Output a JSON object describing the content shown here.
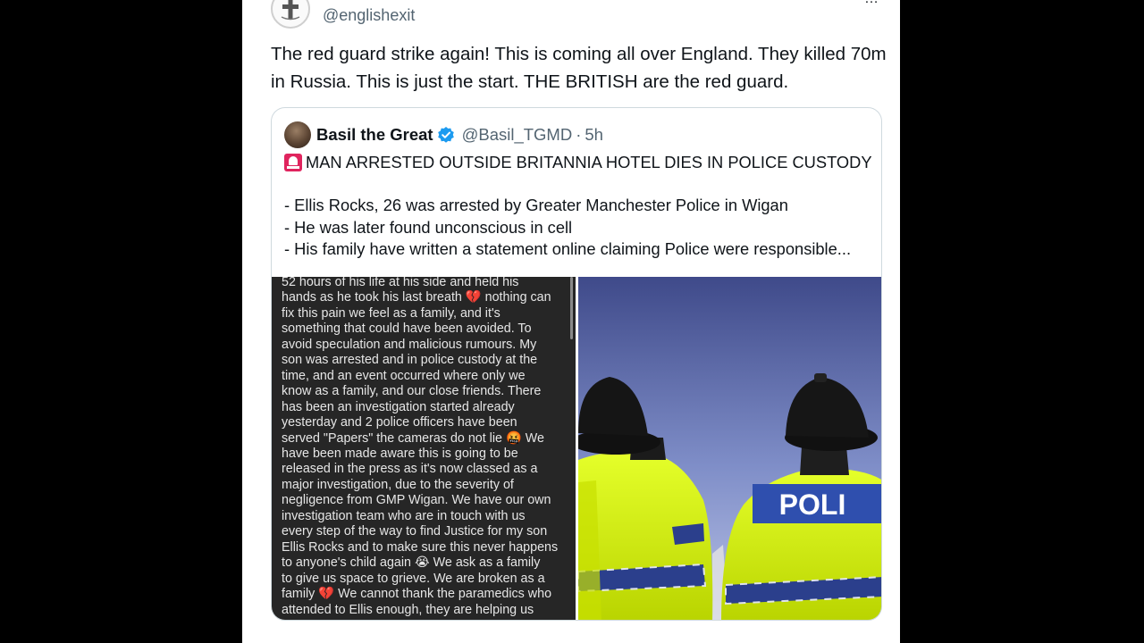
{
  "original_tweet": {
    "handle": "@englishexit",
    "top_right_text": "…",
    "text": "The red guard strike again! This is coming all over England. They killed 70m in Russia. This is just the start. THE BRITISH are the red guard."
  },
  "quoted_tweet": {
    "display_name": "Basil the Great",
    "handle": "@Basil_TGMD",
    "separator": "·",
    "time": "5h",
    "title": "MAN ARRESTED OUTSIDE BRITANNIA HOTEL DIES IN POLICE CUSTODY",
    "title_icon": "police-siren-icon",
    "bullets": [
      "- Ellis Rocks, 26 was arrested by Greater Manchester Police in Wigan",
      "- He was later found unconscious in cell",
      "- His family have written a statement online claiming Police were responsible..."
    ],
    "statement_lines": [
      "52 hours of his life at his side and held his",
      "hands as he took his last breath 💔 nothing can",
      "fix this pain we feel as a family, and it's",
      "something that could have been avoided. To",
      "avoid speculation and malicious rumours. My",
      "son was arrested and in police custody at  the",
      "time, and an event occurred where only we",
      "know as a family, and our close friends. There",
      "has been an investigation started already",
      "yesterday and 2 police officers have been",
      "served \"Papers\" the cameras do not lie 🤬   We",
      "have been made aware this is going to be",
      "released in the press  as it's now classed as a",
      "major investigation, due to the severity of",
      "negligence from GMP Wigan. We have our own",
      "investigation team who are in touch with us",
      "every step of the way to find Justice for my son",
      "Ellis Rocks and to make sure this never happens",
      "to anyone's child again 😭  We ask as a family",
      "to give us space to grieve. We are broken as a",
      "family 💔 We cannot thank the paramedics who",
      "attended to Ellis enough, they are helping us"
    ],
    "photo_text": "POLI"
  },
  "colors": {
    "verified_blue": "#1d9bf0",
    "secondary_text": "#536471",
    "primary_text": "#0f1419",
    "hi_vis_yellow": "#d8f000"
  }
}
